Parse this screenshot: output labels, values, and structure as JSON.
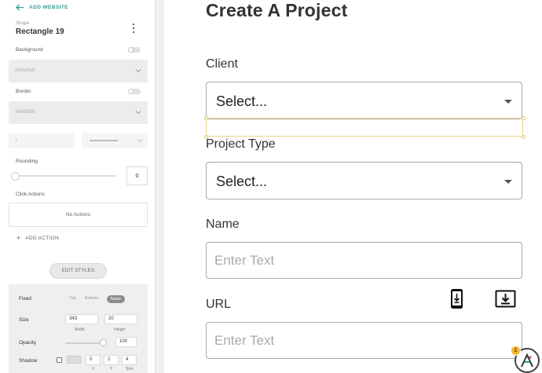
{
  "panel": {
    "back_link": "ADD WEBSITE",
    "shape_kicker": "Shape",
    "shape_name": "Rectangle 19",
    "background_label": "Background",
    "background_value": "#e0e0e0",
    "border_label": "Border",
    "border_value": "#808080",
    "border_width_placeholder": "1",
    "rounding_label": "Rounding",
    "rounding_value": "0",
    "click_actions_label": "Click Actions",
    "no_actions": "No Actions",
    "add_action": "ADD ACTION",
    "edit_styles": "EDIT STYLES"
  },
  "styles": {
    "fixed_label": "Fixed",
    "fixed_options": [
      "Top",
      "Bottom",
      "None"
    ],
    "fixed_selected": "None",
    "size_label": "Size",
    "width_value": "343",
    "height_value": "20",
    "width_caption": "Width",
    "height_caption": "Height",
    "opacity_label": "Opacity",
    "opacity_value": "100",
    "shadow_label": "Shadow",
    "shadow_x": "0",
    "shadow_y": "2",
    "shadow_size": "4",
    "shadow_x_caption": "X",
    "shadow_y_caption": "Y",
    "shadow_size_caption": "Size"
  },
  "form": {
    "title": "Create A Project",
    "client_label": "Client",
    "client_value": "Select...",
    "project_type_label": "Project Type",
    "project_type_value": "Select...",
    "name_label": "Name",
    "name_placeholder": "Enter Text",
    "url_label": "URL",
    "url_placeholder": "Enter Text"
  },
  "assistant": {
    "badge_count": "1"
  },
  "colors": {
    "accent": "#2f9e96",
    "selection": "#e7d58a",
    "badge": "#f2b533"
  }
}
